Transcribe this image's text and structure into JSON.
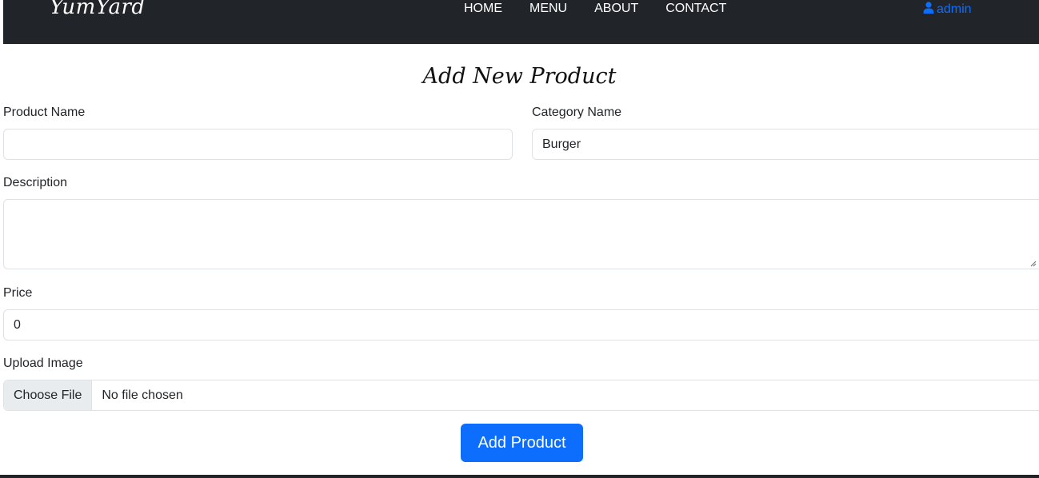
{
  "navbar": {
    "brand": "YumYard",
    "links": [
      "HOME",
      "MENU",
      "ABOUT",
      "CONTACT"
    ],
    "user": "admin",
    "user_icon": "user-icon"
  },
  "form": {
    "title": "Add New Product",
    "product_name": {
      "label": "Product Name",
      "value": ""
    },
    "category": {
      "label": "Category Name",
      "value": "Burger"
    },
    "description": {
      "label": "Description",
      "value": ""
    },
    "price": {
      "label": "Price",
      "value": "0"
    },
    "image": {
      "label": "Upload Image",
      "button": "Choose File",
      "status": "No file chosen"
    },
    "submit_label": "Add Product"
  },
  "colors": {
    "navbar_bg": "#212529",
    "accent": "#0d6efd"
  }
}
